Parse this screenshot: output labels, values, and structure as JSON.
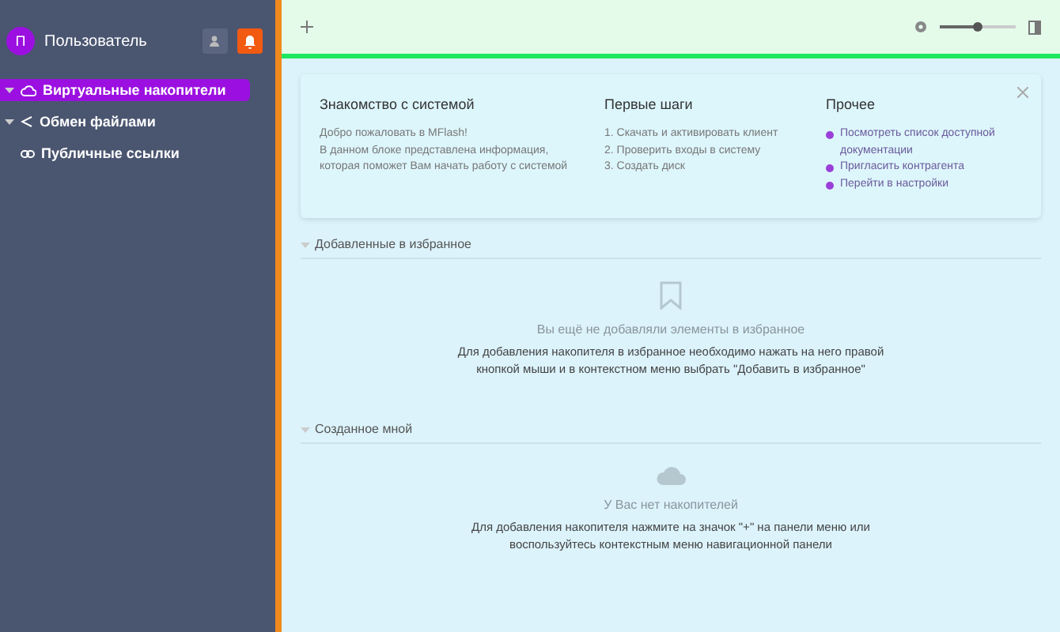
{
  "sidebar": {
    "user": {
      "initial": "П",
      "name": "Пользователь"
    },
    "items": [
      {
        "label": "Виртуальные накопители",
        "selected": true,
        "expanded": true
      },
      {
        "label": "Обмен файлами",
        "selected": false,
        "expanded": true
      },
      {
        "label": "Публичные ссылки",
        "selected": false
      }
    ]
  },
  "toolbar": {
    "zoom": {
      "level": 0.5
    }
  },
  "intro": {
    "columns": [
      {
        "title": "Знакомство с системой",
        "kind": "text",
        "lines": [
          "Добро пожаловать в MFlash!",
          "В данном блоке представлена информация, которая поможет Вам начать работу с системой"
        ]
      },
      {
        "title": "Первые шаги",
        "kind": "steps",
        "lines": [
          "1. Скачать и активировать клиент",
          "2. Проверить входы в систему",
          "3. Создать диск"
        ]
      },
      {
        "title": "Прочее",
        "kind": "links",
        "lines": [
          "Посмотреть список доступной документации",
          "Пригласить контрагента",
          "Перейти в настройки"
        ]
      }
    ]
  },
  "sections": [
    {
      "title": "Добавленные в избранное",
      "expanded": true,
      "empty_title": "Вы ещё не добавляли элементы в избранное",
      "empty_text": "Для добавления накопителя в избранное необходимо нажать на него правой кнопкой мыши и в контекстном меню выбрать \"Добавить в избранное\""
    },
    {
      "title": "Созданное мной",
      "expanded": true,
      "empty_title": "У Вас нет накопителей",
      "empty_text": "Для добавления накопителя нажмите на значок \"+\" на панели меню или воспользуйтесь контекстным меню навигационной панели"
    }
  ]
}
